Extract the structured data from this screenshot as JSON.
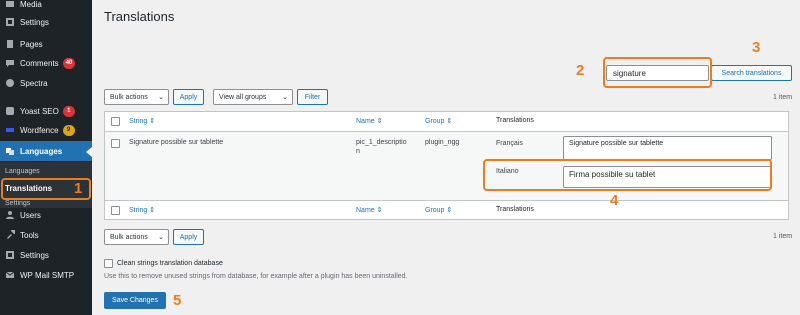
{
  "sidebar": {
    "items": [
      {
        "label": "Media",
        "icon": "media-icon"
      },
      {
        "label": "Settings",
        "icon": "settings-icon"
      },
      {
        "label": "Pages",
        "icon": "pages-icon"
      },
      {
        "label": "Comments",
        "icon": "comments-icon",
        "badge": "40"
      },
      {
        "label": "Spectra",
        "icon": "spectra-icon"
      },
      {
        "label": "Yoast SEO",
        "icon": "yoast-icon",
        "badge": "1"
      },
      {
        "label": "Wordfence",
        "icon": "wordfence-icon",
        "badge": "9"
      },
      {
        "label": "Languages",
        "icon": "languages-icon",
        "active": true
      },
      {
        "label": "Users",
        "icon": "users-icon"
      },
      {
        "label": "Tools",
        "icon": "tools-icon"
      },
      {
        "label": "Settings",
        "icon": "settings-icon"
      },
      {
        "label": "WP Mail SMTP",
        "icon": "mail-icon"
      }
    ],
    "submenu": {
      "languages": "Languages",
      "translations": "Translations",
      "settings": "Settings"
    }
  },
  "page": {
    "title": "Translations"
  },
  "search": {
    "value": "signature",
    "button": "Search translations"
  },
  "toolbar_top": {
    "bulk_actions": "Bulk actions",
    "apply": "Apply",
    "groups_filter": "View all groups",
    "filter": "Filter",
    "count": "1 item"
  },
  "table": {
    "headers": {
      "string": "String",
      "name": "Name",
      "group": "Group",
      "translations": "Translations"
    },
    "row": {
      "string": "Signature possible sur tablette",
      "name": "pic_1_description",
      "name_line1": "pic_1_descriptio",
      "name_line2": "n",
      "group": "plugin_ngg",
      "translations": [
        {
          "language": "Français",
          "value": "Signature possible sur tablette"
        },
        {
          "language": "Italiano",
          "value": "Firma possibile su tablet"
        }
      ]
    }
  },
  "toolbar_bottom": {
    "bulk_actions": "Bulk actions",
    "apply": "Apply",
    "count": "1 item"
  },
  "clean": {
    "label": "Clean strings translation database",
    "note": "Use this to remove unused strings from database, for example after a plugin has been uninstalled."
  },
  "save_button": "Save Changes",
  "annotations": [
    "1",
    "2",
    "3",
    "4",
    "5"
  ],
  "colors": {
    "sidebar_bg": "#1d2327",
    "accent": "#2271b1",
    "annotation": "#ec7c1e"
  }
}
